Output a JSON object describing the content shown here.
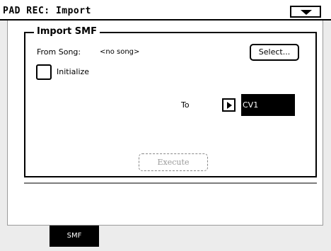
{
  "window": {
    "title": "PAD REC: Import"
  },
  "menu": {
    "icon": "triangle-down-icon"
  },
  "group": {
    "title": "Import SMF"
  },
  "from_song": {
    "label": "From Song:",
    "value": "<no song>",
    "select_label": "Select..."
  },
  "initialize": {
    "label": "Initialize",
    "checked": false
  },
  "to": {
    "label": "To",
    "value": "CV1",
    "arrow_icon": "triangle-right-icon"
  },
  "execute": {
    "label": "Execute",
    "enabled": false
  },
  "tabs": [
    {
      "label": "SMF",
      "selected": true
    }
  ]
}
